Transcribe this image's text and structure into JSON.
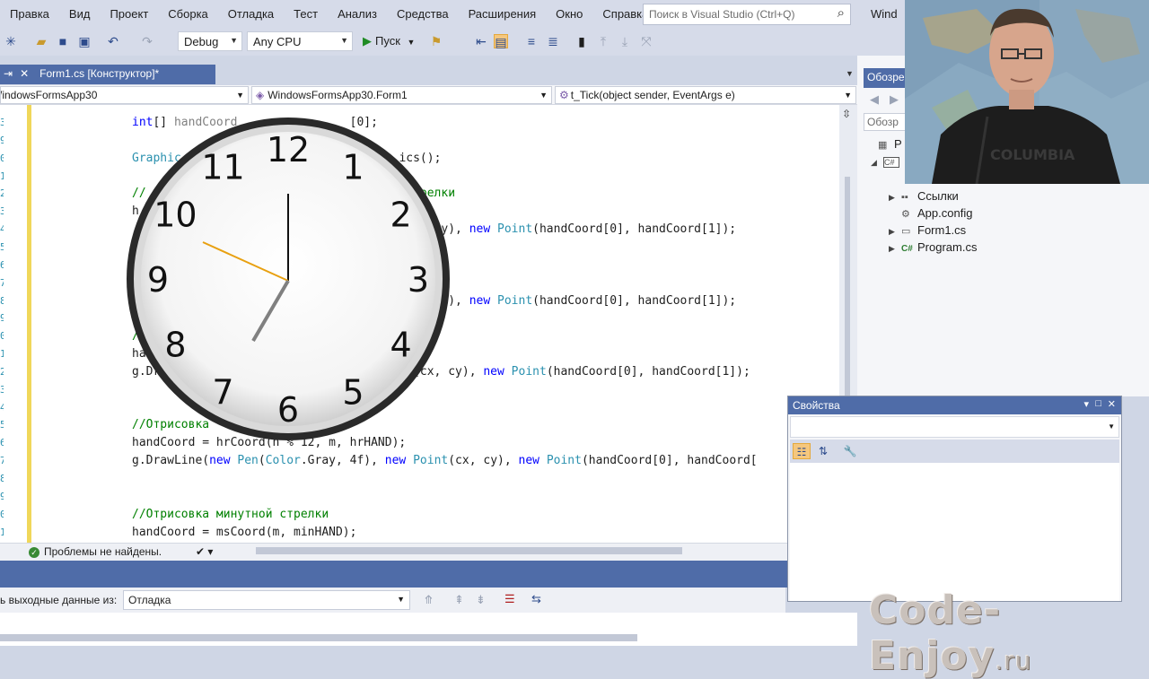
{
  "menu": [
    "Правка",
    "Вид",
    "Проект",
    "Сборка",
    "Отладка",
    "Тест",
    "Анализ",
    "Средства",
    "Расширения",
    "Окно",
    "Справка"
  ],
  "search": {
    "placeholder": "Поиск в Visual Studio (Ctrl+Q)"
  },
  "window_title_tail": "Wind",
  "toolbar": {
    "config": "Debug",
    "platform": "Any CPU",
    "run_label": "Пуск"
  },
  "tabs": {
    "active": "Form1.cs [Конструктор]*"
  },
  "navbar": {
    "project": "WindowsFormsApp30",
    "class": "WindowsFormsApp30.Form1",
    "member": "t_Tick(object sender, EventArgs e)"
  },
  "editor": {
    "line_digits": [
      "3",
      "9",
      "0",
      "1",
      "2",
      "3",
      "4",
      "5",
      "6",
      "7",
      "8",
      "9",
      "0",
      "1",
      "2",
      "3",
      "4",
      "5",
      "6",
      "7",
      "8",
      "9",
      "0",
      "1",
      "2"
    ],
    "lines": [
      [
        [
          "kw",
          "int"
        ],
        [
          "",
          "[] "
        ],
        [
          "mu",
          "handCoord"
        ],
        [
          "",
          "                [0];"
        ]
      ],
      [],
      [
        [
          "ty",
          "Graphic"
        ],
        [
          "",
          "                               "
        ],
        [
          "",
          "ics();"
        ]
      ],
      [],
      [
        [
          "cm",
          "//                                 ной стрелки"
        ]
      ],
      [
        [
          "",
          "h"
        ]
      ],
      [
        [
          "",
          "                                 "
        ],
        [
          "ty",
          "Point"
        ],
        [
          "",
          "(cx, cy), "
        ],
        [
          "kw",
          "new"
        ],
        [
          "",
          " "
        ],
        [
          "ty",
          "Point"
        ],
        [
          "",
          "(handCoord[0], handCoord[1]);"
        ]
      ],
      [],
      [
        [
          "cm",
          "                                   трелки"
        ]
      ],
      [],
      [
        [
          "",
          "                                 "
        ],
        [
          "ty",
          "Point"
        ],
        [
          "",
          "(cx, cy), "
        ],
        [
          "kw",
          "new"
        ],
        [
          "",
          " "
        ],
        [
          "ty",
          "Point"
        ],
        [
          "",
          "(handCoord[0], handCoord[1]);"
        ]
      ],
      [],
      [
        [
          "cm",
          "//                                 трелки"
        ]
      ],
      [
        [
          "",
          "ha                               4);"
        ]
      ],
      [
        [
          "",
          "g.Dr                            "
        ],
        [
          "kw",
          "ew"
        ],
        [
          "",
          " "
        ],
        [
          "ty",
          "Point"
        ],
        [
          "",
          "(cx, cy), "
        ],
        [
          "kw",
          "new"
        ],
        [
          "",
          " "
        ],
        [
          "ty",
          "Point"
        ],
        [
          "",
          "(handCoord[0], handCoord[1]);"
        ]
      ],
      [],
      [],
      [
        [
          "cm",
          "//Отрисовка"
        ]
      ],
      [
        [
          "",
          "handCoord = hrCoord(h % 12, m, hrHAND);"
        ]
      ],
      [
        [
          "",
          "g.DrawLine("
        ],
        [
          "kw",
          "new"
        ],
        [
          "",
          " "
        ],
        [
          "ty",
          "Pen"
        ],
        [
          "",
          "("
        ],
        [
          "ty",
          "Color"
        ],
        [
          "",
          ".Gray, 4f), "
        ],
        [
          "kw",
          "new"
        ],
        [
          "",
          " "
        ],
        [
          "ty",
          "Point"
        ],
        [
          "",
          "(cx, cy), "
        ],
        [
          "kw",
          "new"
        ],
        [
          "",
          " "
        ],
        [
          "ty",
          "Point"
        ],
        [
          "",
          "(handCoord[0], handCoord["
        ]
      ],
      [],
      [],
      [
        [
          "cm",
          "//Отрисовка минутной стрелки"
        ]
      ],
      [
        [
          "",
          "handCoord = msCoord(m, minHAND);"
        ]
      ]
    ],
    "status": "Проблемы не найдены."
  },
  "output": {
    "label": "ь выходные данные из:",
    "source": "Отладка"
  },
  "solution_explorer": {
    "title": "Обозре",
    "search": "Обозр",
    "items": [
      {
        "label": "Р",
        "icon": "solution-icon"
      },
      {
        "label": "",
        "icon": "csharp-project-icon"
      },
      {
        "label": "Ссылки",
        "icon": "references-icon"
      },
      {
        "label": "App.config",
        "icon": "config-icon"
      },
      {
        "label": "Form1.cs",
        "icon": "form-icon"
      },
      {
        "label": "Program.cs",
        "icon": "csharp-file-icon"
      }
    ]
  },
  "properties": {
    "title": "Свойства"
  },
  "clock": {
    "numbers": [
      "12",
      "1",
      "2",
      "3",
      "4",
      "5",
      "6",
      "7",
      "8",
      "9",
      "10",
      "11"
    ]
  },
  "watermark": {
    "main": "Code-Enjoy",
    "tld": ".ru"
  },
  "colors": {
    "accent": "#4f6ca8",
    "keyword": "#0000ff",
    "type": "#2b91af",
    "comment": "#008000",
    "chrome": "#d6dbe9"
  }
}
